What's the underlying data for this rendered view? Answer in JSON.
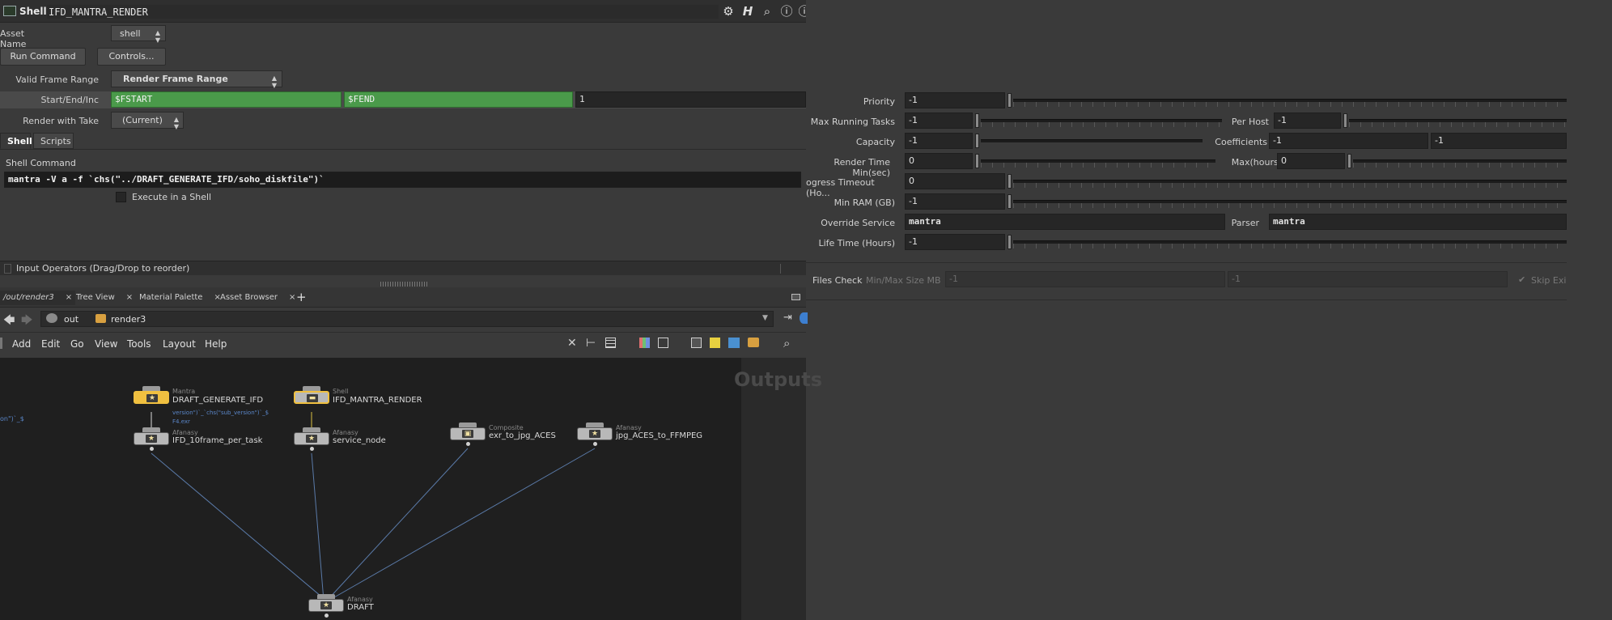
{
  "titlebar": {
    "node_type": "Shell",
    "node_name": "IFD_MANTRA_RENDER"
  },
  "params": {
    "asset_name_label": "Asset Name",
    "asset_name_value": "shell",
    "run_command": "Run Command",
    "controls": "Controls...",
    "valid_frame_range_label": "Valid Frame Range",
    "valid_frame_range_value": "Render Frame Range",
    "start_end_inc_label": "Start/End/Inc",
    "start": "$FSTART",
    "end": "$FEND",
    "inc": "1",
    "render_with_take_label": "Render with Take",
    "render_with_take_value": "(Current)"
  },
  "tabs": [
    "Shell",
    "Scripts"
  ],
  "shell": {
    "command_label": "Shell Command",
    "command_value": "mantra -V a -f `chs(\"../DRAFT_GENERATE_IFD/soho_diskfile\")`",
    "execute_label": "Execute in a Shell",
    "input_operators": "Input Operators (Drag/Drop to reorder)"
  },
  "right": {
    "priority_label": "Priority",
    "priority": "-1",
    "max_running_label": "Max Running Tasks",
    "max_running": "-1",
    "per_host_label": "Per Host",
    "per_host": "-1",
    "capacity_label": "Capacity",
    "capacity": "-1",
    "coefficients_label": "Coefficients",
    "coef1": "-1",
    "coef2": "-1",
    "render_time_label": "Render Time Min(sec)",
    "render_time": "0",
    "max_hours_label": "Max(hours)",
    "max_hours": "0",
    "progress_timeout_label": "ogress Timeout (Ho...",
    "progress_timeout": "0",
    "min_ram_label": "Min RAM (GB)",
    "min_ram": "-1",
    "override_service_label": "Override Service",
    "override_service": "mantra",
    "parser_label": "Parser",
    "parser": "mantra",
    "life_time_label": "Life Time (Hours)",
    "life_time": "-1",
    "files_check_label": "Files Check",
    "min_max_label": "Min/Max Size MB",
    "min_size": "-1",
    "max_size": "-1",
    "skip_label": "Skip Exi"
  },
  "network": {
    "tabs": [
      {
        "label": "/out/render3"
      },
      {
        "label": "Tree View"
      },
      {
        "label": "Material Palette"
      },
      {
        "label": "Asset Browser"
      }
    ],
    "add_tab": "+",
    "crumb_out": "out",
    "crumb_render": "render3",
    "menus": [
      "Add",
      "Edit",
      "Go",
      "View",
      "Tools",
      "Layout",
      "Help"
    ],
    "watermark": "Outputs",
    "left_snippet": "on\")`_$",
    "expr_line1": "version\")`_`chs(\"sub_version\")`_$",
    "expr_line2": "F4.exr",
    "nodes": [
      {
        "type": "Mantra",
        "name": "DRAFT_GENERATE_IFD"
      },
      {
        "type": "Shell",
        "name": "IFD_MANTRA_RENDER"
      },
      {
        "type": "Afanasy",
        "name": "IFD_10frame_per_task"
      },
      {
        "type": "Afanasy",
        "name": "service_node"
      },
      {
        "type": "Composite",
        "name": "exr_to_jpg_ACES"
      },
      {
        "type": "Afanasy",
        "name": "jpg_ACES_to_FFMPEG"
      },
      {
        "type": "Afanasy",
        "name": "DRAFT"
      }
    ]
  }
}
